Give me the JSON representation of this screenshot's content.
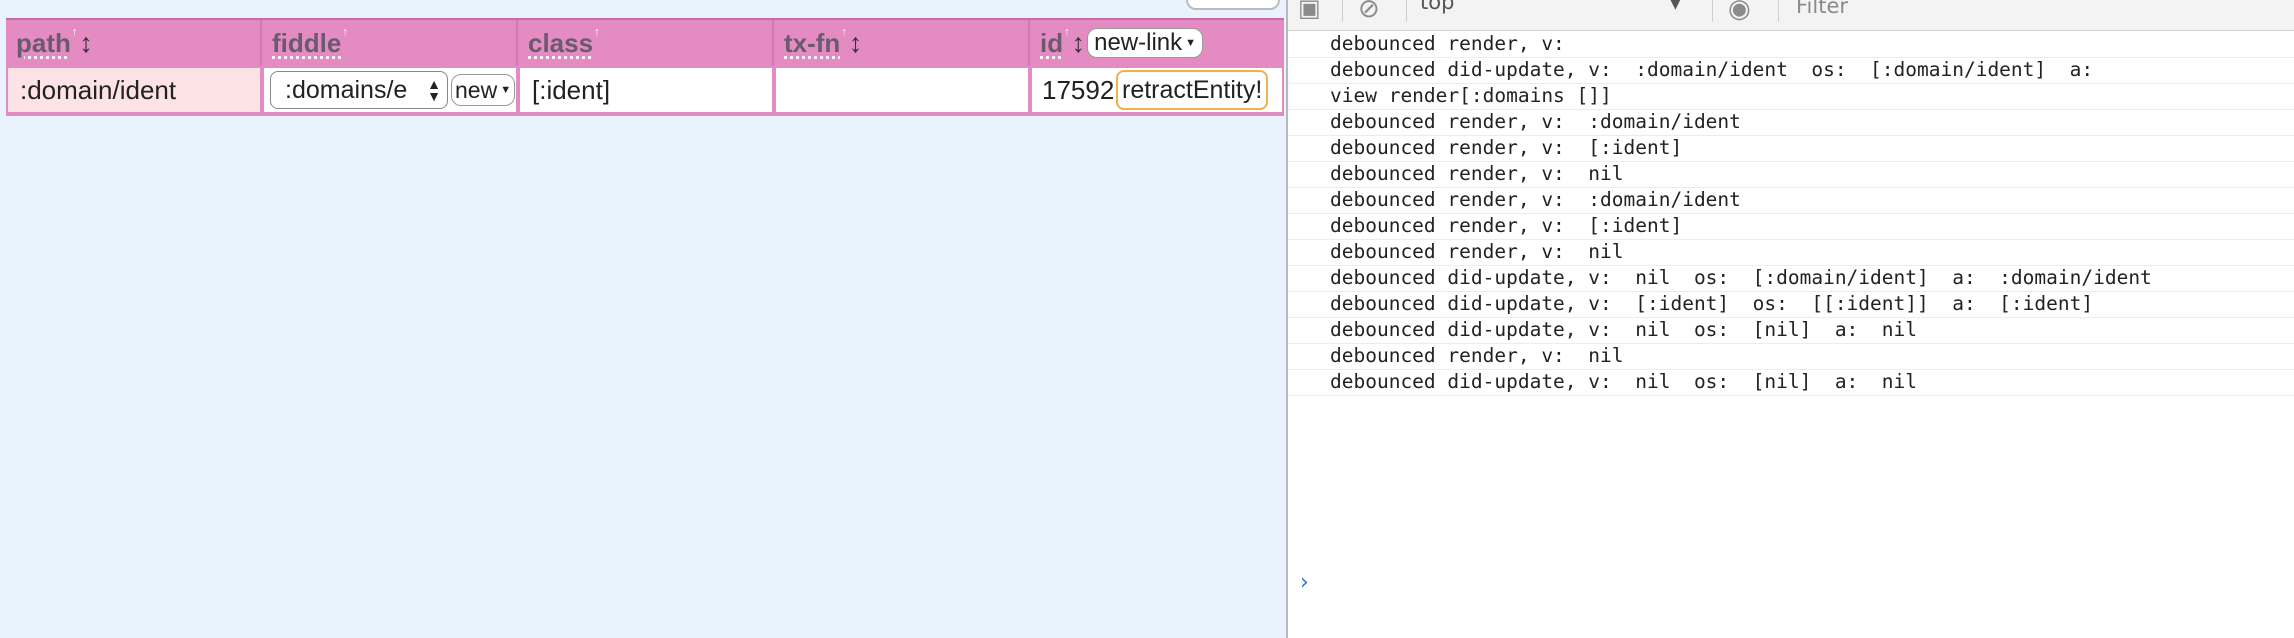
{
  "app": {
    "table": {
      "columns": [
        {
          "label": "path",
          "sort_mark": "↑",
          "reorder": "↕"
        },
        {
          "label": "fiddle",
          "sort_mark": "↑"
        },
        {
          "label": "class",
          "sort_mark": "↑"
        },
        {
          "label": "tx-fn",
          "sort_mark": "↑",
          "reorder": "↕"
        },
        {
          "label": "id",
          "sort_mark": "↑",
          "reorder": "↕",
          "menu_label": "new-link"
        }
      ],
      "row": {
        "path": ":domain/ident",
        "fiddle_value": ":domains/e",
        "fiddle_new_label": "new",
        "class": "[:ident]",
        "tx_fn": "",
        "id": "17592",
        "action_label": "retractEntity!"
      }
    }
  },
  "devtools": {
    "context": "top",
    "filter_placeholder": "Filter",
    "prompt": "›",
    "logs": [
      "debounced render, v:",
      "debounced did-update, v:  :domain/ident  os:  [:domain/ident]  a:",
      "view render[:domains []]",
      "debounced render, v:  :domain/ident",
      "debounced render, v:  [:ident]",
      "debounced render, v:  nil",
      "debounced render, v:  :domain/ident",
      "debounced render, v:  [:ident]",
      "debounced render, v:  nil",
      "debounced did-update, v:  nil  os:  [:domain/ident]  a:  :domain/ident",
      "debounced did-update, v:  [:ident]  os:  [[:ident]]  a:  [:ident]",
      "debounced did-update, v:  nil  os:  [nil]  a:  nil",
      "debounced render, v:  nil",
      "debounced did-update, v:  nil  os:  [nil]  a:  nil"
    ]
  }
}
